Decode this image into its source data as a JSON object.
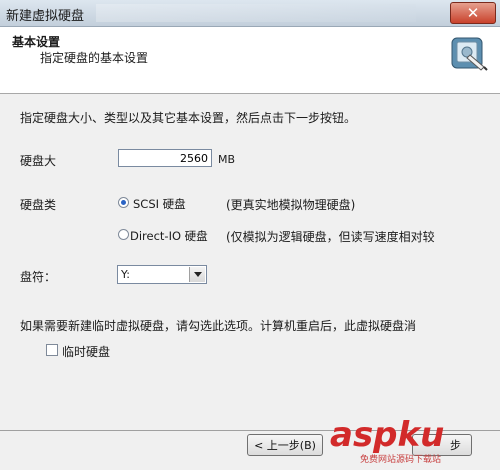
{
  "window": {
    "title": "新建虚拟硬盘",
    "close_label": "✕"
  },
  "header": {
    "title": "基本设置",
    "subtitle": "指定硬盘的基本设置"
  },
  "content": {
    "intro": "指定硬盘大小、类型以及其它基本设置，然后点击下一步按钮。",
    "size": {
      "label": "硬盘大",
      "value": "2560",
      "unit": "MB"
    },
    "type": {
      "label": "硬盘类",
      "options": [
        {
          "label": "SCSI 硬盘",
          "desc": "(更真实地模拟物理硬盘)",
          "checked": true
        },
        {
          "label": "Direct-IO 硬盘",
          "desc": "(仅模拟为逻辑硬盘，但读写速度相对较",
          "checked": false
        }
      ]
    },
    "drive": {
      "label": "盘符：",
      "value": "Y:"
    },
    "temp_note": "如果需要新建临时虚拟硬盘，请勾选此选项。计算机重启后，此虚拟硬盘消",
    "temp_checkbox": {
      "label": "临时硬盘",
      "checked": false
    }
  },
  "footer": {
    "back_label": "< 上一步(B)",
    "next_label": "步"
  },
  "watermark": {
    "logo": "aspku",
    "sub": "免费网站源码下载站"
  },
  "colors": {
    "accent": "#2a63c4",
    "header_bg": "#ffffff",
    "dialog_bg": "#f0f0f0",
    "watermark": "#d22a2a"
  }
}
